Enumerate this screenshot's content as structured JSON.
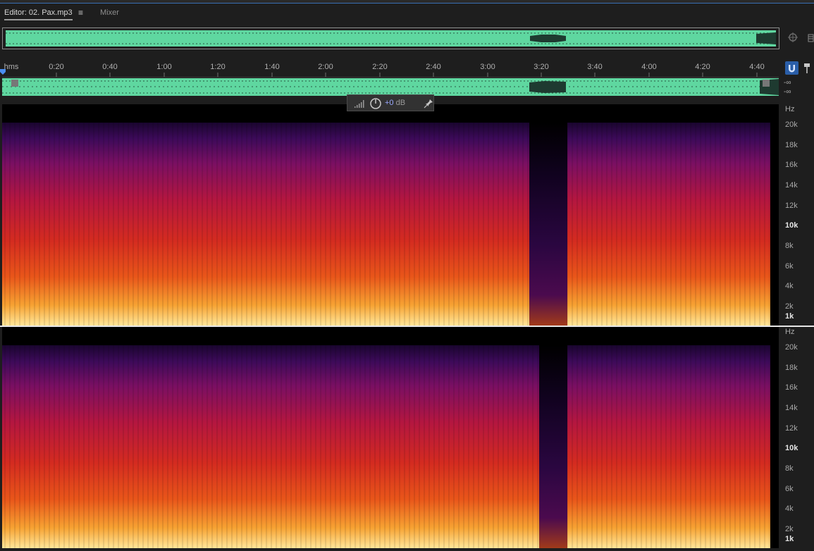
{
  "tabs": {
    "editor_label": "Editor: 02. Pax.mp3",
    "menu_glyph": "≡",
    "mixer_label": "Mixer"
  },
  "ruler": {
    "unit": "hms",
    "ticks": [
      "0:20",
      "0:40",
      "1:00",
      "1:20",
      "1:40",
      "2:00",
      "2:20",
      "2:40",
      "3:00",
      "3:20",
      "3:40",
      "4:00",
      "4:20",
      "4:40"
    ]
  },
  "channels": {
    "level_top": "-∞",
    "level_bottom": "-∞"
  },
  "hud": {
    "gain_value": "+0",
    "gain_unit": "dB"
  },
  "freq_axis": {
    "unit": "Hz",
    "labels": [
      "20k",
      "18k",
      "16k",
      "14k",
      "12k",
      "10k",
      "8k",
      "6k",
      "4k",
      "2k",
      "1k"
    ]
  },
  "colors": {
    "waveform": "#5fd7a0",
    "accent": "#2a5ea8",
    "gain_text": "#9aa9ff"
  },
  "icons": {
    "zoom": "zoom-icon",
    "menu": "hamburger-icon",
    "snap": "snap-magnet-icon",
    "marker": "marker-pin-icon",
    "pin": "pin-icon",
    "power": "power-icon",
    "meter": "level-meter-icon"
  }
}
